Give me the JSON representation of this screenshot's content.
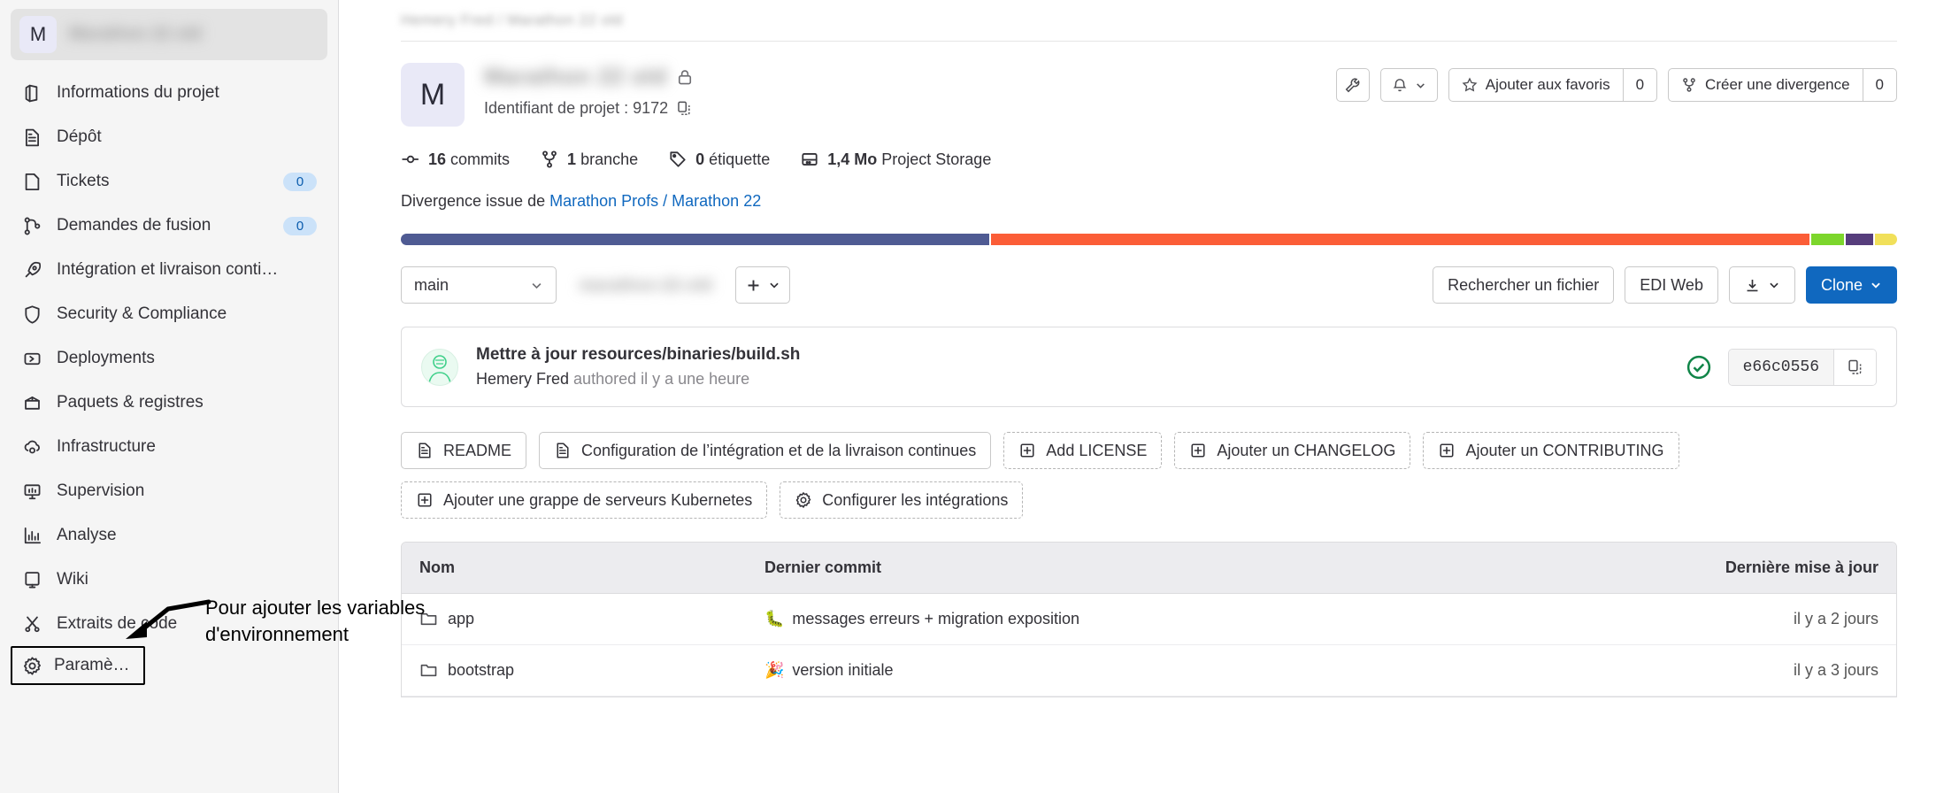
{
  "sidebar": {
    "project_initial": "M",
    "project_name_blurred": "Marathon 22 old",
    "items": [
      {
        "label": "Informations du projet",
        "icon": "project-info-icon",
        "badge": null
      },
      {
        "label": "Dépôt",
        "icon": "repository-icon",
        "badge": null
      },
      {
        "label": "Tickets",
        "icon": "issues-icon",
        "badge": "0"
      },
      {
        "label": "Demandes de fusion",
        "icon": "merge-request-icon",
        "badge": "0"
      },
      {
        "label": "Intégration et livraison conti…",
        "icon": "rocket-icon",
        "badge": null
      },
      {
        "label": "Security & Compliance",
        "icon": "shield-icon",
        "badge": null
      },
      {
        "label": "Deployments",
        "icon": "deployments-icon",
        "badge": null
      },
      {
        "label": "Paquets & registres",
        "icon": "package-icon",
        "badge": null
      },
      {
        "label": "Infrastructure",
        "icon": "cloud-gear-icon",
        "badge": null
      },
      {
        "label": "Supervision",
        "icon": "monitor-icon",
        "badge": null
      },
      {
        "label": "Analyse",
        "icon": "chart-icon",
        "badge": null
      },
      {
        "label": "Wiki",
        "icon": "book-icon",
        "badge": null
      },
      {
        "label": "Extraits de code",
        "icon": "snippet-icon",
        "badge": null
      },
      {
        "label": "Paramètres",
        "icon": "gear-icon",
        "badge": null
      }
    ]
  },
  "annotation": {
    "text": "Pour ajouter les variables d'environnement"
  },
  "breadcrumb": {
    "text": "Hemery Fred  /  Marathon 22 old"
  },
  "project": {
    "initial": "M",
    "name_blurred": "Marathon 22 old",
    "visibility_icon": "lock-icon",
    "id_label": "Identifiant de projet : 9172",
    "copy_icon": "copy-icon",
    "stats": [
      {
        "icon": "commit-icon",
        "value": "16",
        "label": "commits"
      },
      {
        "icon": "branch-icon",
        "value": "1",
        "label": "branche"
      },
      {
        "icon": "tag-icon",
        "value": "0",
        "label": "étiquette"
      },
      {
        "icon": "storage-icon",
        "value": "1,4 Mo",
        "label": "Project Storage"
      }
    ],
    "fork_prefix": "Divergence issue de ",
    "fork_link": "Marathon Profs / Marathon 22"
  },
  "header_actions": {
    "wrench_icon": "wrench-icon",
    "bell_icon": "bell-icon",
    "chevron_icon": "chevron-down-icon",
    "star_label": "Ajouter aux favoris",
    "star_count": "0",
    "star_icon": "star-icon",
    "fork_label": "Créer une divergence",
    "fork_count": "0",
    "fork_icon": "fork-icon"
  },
  "languages": [
    {
      "name": "segment-1",
      "color": "#4f5b93",
      "pct": 39.5
    },
    {
      "name": "segment-2",
      "color": "#fb5d37",
      "pct": 55.0
    },
    {
      "name": "segment-3",
      "color": "#7cd62c",
      "pct": 2.2
    },
    {
      "name": "segment-4",
      "color": "#563d7c",
      "pct": 1.8
    },
    {
      "name": "segment-5",
      "color": "#f1e05a",
      "pct": 1.5
    }
  ],
  "toolbar": {
    "branch": "main",
    "path_blurred": "marathon-22-old",
    "plus_icon": "plus-icon",
    "search_file": "Rechercher un fichier",
    "web_ide": "EDI Web",
    "download_icon": "download-icon",
    "clone": "Clone"
  },
  "commit": {
    "title": "Mettre à jour resources/binaries/build.sh",
    "author": "Hemery Fred",
    "meta": "authored il y a une heure",
    "status_icon": "check-circle-icon",
    "sha": "e66c0556",
    "copy_icon": "copy-icon"
  },
  "quick_actions": [
    {
      "label": "README",
      "icon": "file-icon",
      "dashed": false
    },
    {
      "label": "Configuration de l’intégration et de la livraison continues",
      "icon": "file-icon",
      "dashed": false
    },
    {
      "label": "Add LICENSE",
      "icon": "plus-square-icon",
      "dashed": true
    },
    {
      "label": "Ajouter un CHANGELOG",
      "icon": "plus-square-icon",
      "dashed": true
    },
    {
      "label": "Ajouter un CONTRIBUTING",
      "icon": "plus-square-icon",
      "dashed": true
    },
    {
      "label": "Ajouter une grappe de serveurs Kubernetes",
      "icon": "plus-square-icon",
      "dashed": true
    },
    {
      "label": "Configurer les intégrations",
      "icon": "gear-icon",
      "dashed": true
    }
  ],
  "file_table": {
    "columns": {
      "name": "Nom",
      "last_commit": "Dernier commit",
      "updated": "Dernière mise à jour"
    },
    "rows": [
      {
        "name": "app",
        "icon": "folder-icon",
        "emoji": "🐛",
        "commit": "messages erreurs + migration exposition",
        "updated": "il y a 2 jours"
      },
      {
        "name": "bootstrap",
        "icon": "folder-icon",
        "emoji": "🎉",
        "commit": "version initiale",
        "updated": "il y a 3 jours"
      }
    ]
  }
}
